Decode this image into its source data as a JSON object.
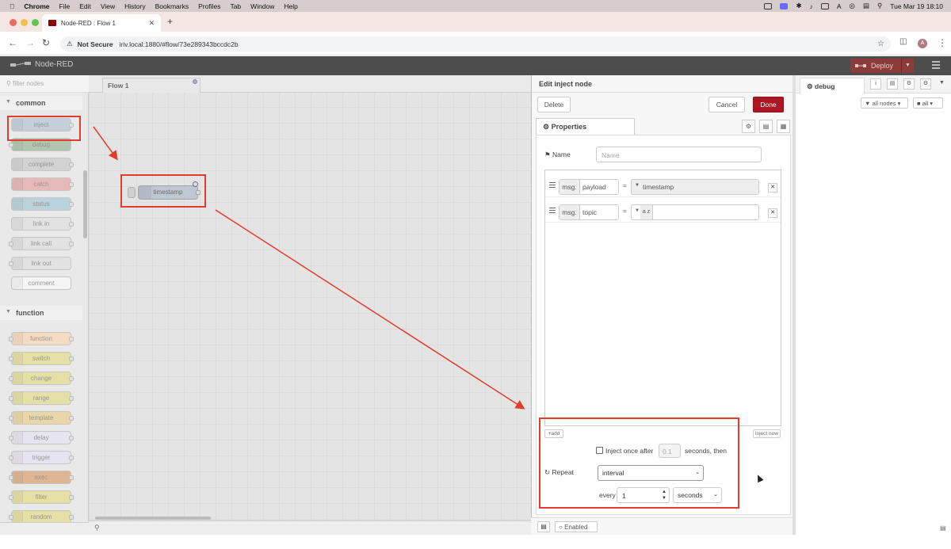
{
  "menubar": {
    "app": "Chrome",
    "items": [
      "File",
      "Edit",
      "View",
      "History",
      "Bookmarks",
      "Profiles",
      "Tab",
      "Window",
      "Help"
    ],
    "clock": "Tue Mar 19  18:10"
  },
  "browser": {
    "tab_title": "Node-RED : Flow 1",
    "security": "Not Secure",
    "url": "iriv.local:1880/#flow/73e289343bccdc2b",
    "profile_initial": "A"
  },
  "header": {
    "brand": "Node-RED",
    "deploy_label": "Deploy"
  },
  "palette": {
    "filter_placeholder": "filter nodes",
    "categories": [
      {
        "name": "common",
        "nodes": [
          {
            "label": "inject",
            "color": "#a6bbcf"
          },
          {
            "label": "debug",
            "color": "#87a980"
          },
          {
            "label": "complete",
            "color": "#c0c0c0"
          },
          {
            "label": "catch",
            "color": "#e49191"
          },
          {
            "label": "status",
            "color": "#94c1d0"
          },
          {
            "label": "link in",
            "color": "#dddddd"
          },
          {
            "label": "link call",
            "color": "#dddddd"
          },
          {
            "label": "link out",
            "color": "#dddddd"
          },
          {
            "label": "comment",
            "color": "#ffffff"
          }
        ]
      },
      {
        "name": "function",
        "nodes": [
          {
            "label": "function",
            "color": "#fdd0a2"
          },
          {
            "label": "switch",
            "color": "#e2d96e"
          },
          {
            "label": "change",
            "color": "#e2d96e"
          },
          {
            "label": "range",
            "color": "#e2d96e"
          },
          {
            "label": "template",
            "color": "#ebc774"
          },
          {
            "label": "delay",
            "color": "#e6e0f8"
          },
          {
            "label": "trigger",
            "color": "#e6e0f8"
          },
          {
            "label": "exec",
            "color": "#d98c4d"
          },
          {
            "label": "filter",
            "color": "#e2d96e"
          },
          {
            "label": "random",
            "color": "#e2d96e"
          }
        ]
      }
    ]
  },
  "workspace": {
    "flow_tab": "Flow 1",
    "node_label": "timestamp",
    "node_color": "#a6bbcf"
  },
  "editor": {
    "title": "Edit inject node",
    "delete": "Delete",
    "cancel": "Cancel",
    "done": "Done",
    "tab": "Properties",
    "name_label": "Name",
    "name_placeholder": "Name",
    "props": [
      {
        "prefix": "msg.",
        "key": "payload",
        "type": "timestamp"
      },
      {
        "prefix": "msg.",
        "key": "topic",
        "type": "a z"
      }
    ],
    "add": "add",
    "inject_now": "inject now",
    "inject_once": "Inject once after",
    "once_value": "0.1",
    "seconds_then": "seconds, then",
    "repeat_label": "Repeat",
    "repeat_value": "interval",
    "every": "every",
    "every_value": "1",
    "unit": "seconds",
    "enabled": "Enabled"
  },
  "sidebar": {
    "tab": "debug",
    "filter": "all nodes",
    "clear": "all"
  },
  "colors": {
    "accent": "#ad1625",
    "annotation": "#e23c2c",
    "header": "#4d4d4d"
  }
}
